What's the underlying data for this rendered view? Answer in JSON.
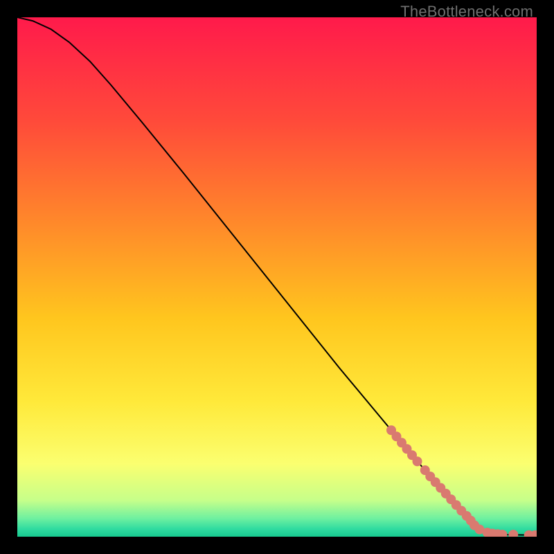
{
  "watermark": "TheBottleneck.com",
  "chart_data": {
    "type": "line",
    "title": "",
    "xlabel": "",
    "ylabel": "",
    "xlim": [
      0,
      100
    ],
    "ylim": [
      0,
      100
    ],
    "grid": false,
    "legend": null,
    "gradient_stops": [
      {
        "offset": 0.0,
        "color": "#ff1a4b"
      },
      {
        "offset": 0.2,
        "color": "#ff4a3a"
      },
      {
        "offset": 0.4,
        "color": "#ff8a2a"
      },
      {
        "offset": 0.58,
        "color": "#ffc61e"
      },
      {
        "offset": 0.74,
        "color": "#ffe93a"
      },
      {
        "offset": 0.86,
        "color": "#fbff70"
      },
      {
        "offset": 0.93,
        "color": "#c6ff8a"
      },
      {
        "offset": 0.965,
        "color": "#6ef0a0"
      },
      {
        "offset": 0.985,
        "color": "#30dba0"
      },
      {
        "offset": 1.0,
        "color": "#17c98f"
      }
    ],
    "series": [
      {
        "name": "curve",
        "color": "#000000",
        "points": [
          {
            "x": 0.0,
            "y": 100.0
          },
          {
            "x": 3.0,
            "y": 99.3
          },
          {
            "x": 6.5,
            "y": 97.7
          },
          {
            "x": 10.0,
            "y": 95.2
          },
          {
            "x": 14.0,
            "y": 91.5
          },
          {
            "x": 18.0,
            "y": 87.0
          },
          {
            "x": 24.0,
            "y": 79.8
          },
          {
            "x": 32.0,
            "y": 70.0
          },
          {
            "x": 42.0,
            "y": 57.5
          },
          {
            "x": 52.0,
            "y": 45.0
          },
          {
            "x": 62.0,
            "y": 32.5
          },
          {
            "x": 72.0,
            "y": 20.5
          },
          {
            "x": 80.0,
            "y": 11.0
          },
          {
            "x": 85.0,
            "y": 5.2
          },
          {
            "x": 88.0,
            "y": 2.2
          },
          {
            "x": 90.0,
            "y": 0.9
          },
          {
            "x": 93.0,
            "y": 0.4
          },
          {
            "x": 100.0,
            "y": 0.3
          }
        ]
      }
    ],
    "highlight_points": {
      "comment": "Salmon markers along the curve near bottom-right",
      "color": "#d97a70",
      "radius_px": 7,
      "points": [
        {
          "x": 72.0,
          "y": 20.5
        },
        {
          "x": 73.0,
          "y": 19.3
        },
        {
          "x": 74.0,
          "y": 18.1
        },
        {
          "x": 75.0,
          "y": 16.9
        },
        {
          "x": 76.0,
          "y": 15.7
        },
        {
          "x": 77.0,
          "y": 14.5
        },
        {
          "x": 78.5,
          "y": 12.8
        },
        {
          "x": 79.5,
          "y": 11.6
        },
        {
          "x": 80.5,
          "y": 10.5
        },
        {
          "x": 81.5,
          "y": 9.4
        },
        {
          "x": 82.5,
          "y": 8.3
        },
        {
          "x": 83.5,
          "y": 7.2
        },
        {
          "x": 84.5,
          "y": 6.1
        },
        {
          "x": 85.5,
          "y": 5.0
        },
        {
          "x": 86.5,
          "y": 4.0
        },
        {
          "x": 87.3,
          "y": 3.1
        },
        {
          "x": 88.0,
          "y": 2.2
        },
        {
          "x": 89.0,
          "y": 1.4
        },
        {
          "x": 90.5,
          "y": 0.8
        },
        {
          "x": 91.5,
          "y": 0.6
        },
        {
          "x": 92.5,
          "y": 0.5
        },
        {
          "x": 93.4,
          "y": 0.4
        },
        {
          "x": 95.5,
          "y": 0.4
        },
        {
          "x": 98.5,
          "y": 0.3
        },
        {
          "x": 99.7,
          "y": 0.3
        }
      ]
    }
  }
}
